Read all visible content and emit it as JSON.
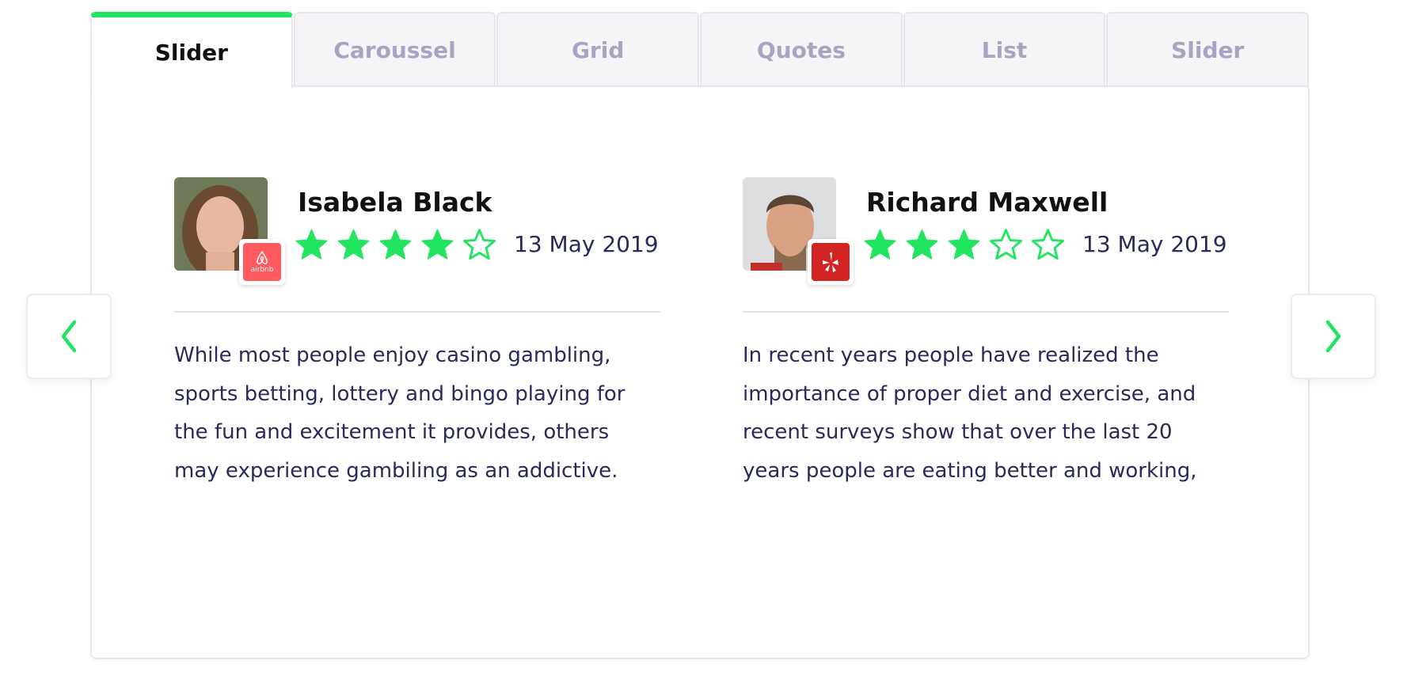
{
  "tabs": [
    {
      "label": "Slider",
      "active": true
    },
    {
      "label": "Caroussel"
    },
    {
      "label": "Grid"
    },
    {
      "label": "Quotes"
    },
    {
      "label": "List"
    },
    {
      "label": "Slider"
    }
  ],
  "colors": {
    "accent": "#22e55f",
    "text": "#2a2a5a",
    "airbnb": "#ff5a5f",
    "yelp": "#d32323"
  },
  "reviews": [
    {
      "name": "Isabela Black",
      "rating": 4,
      "max_rating": 5,
      "date": "13 May 2019",
      "source": "airbnb",
      "source_label": "airbnb",
      "text": "While most people enjoy casino gambling, sports betting, lottery and bingo playing for the fun and excitement it provides, others may experience gambiling as an addictive."
    },
    {
      "name": "Richard Maxwell",
      "rating": 3,
      "max_rating": 5,
      "date": "13 May 2019",
      "source": "yelp",
      "text": "In recent years people have realized the importance of proper diet and exercise, and recent surveys show that over the last 20 years people are eating better and working,"
    }
  ],
  "nav": {
    "prev_icon": "chevron-left-icon",
    "next_icon": "chevron-right-icon"
  }
}
